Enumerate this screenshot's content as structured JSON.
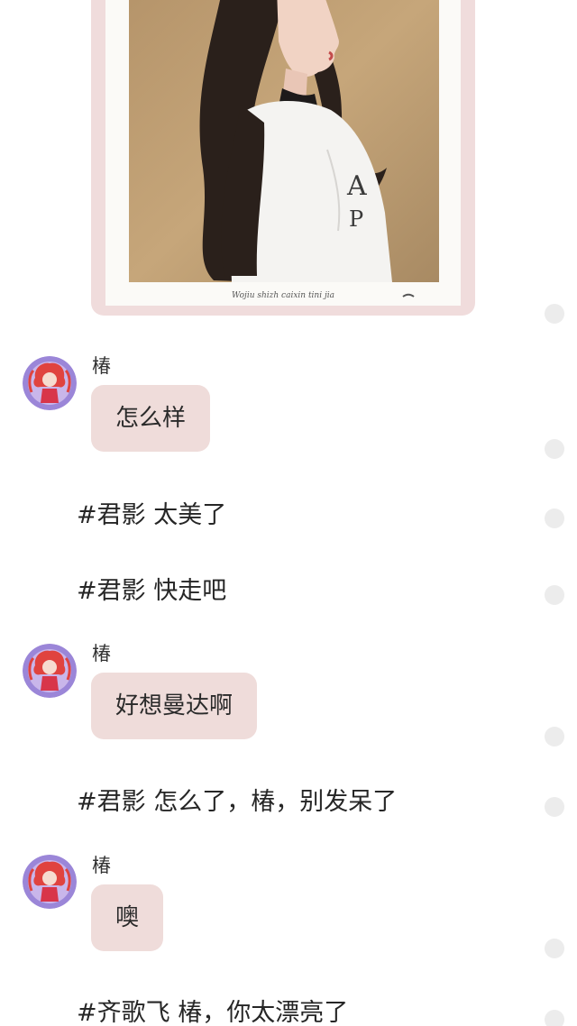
{
  "photo": {
    "caption": "Wojiu shizh caixin tini jia"
  },
  "messages": [
    {
      "type": "chat",
      "sender": "椿",
      "text": "怎么样"
    },
    {
      "type": "narration",
      "text": "#君影 太美了"
    },
    {
      "type": "narration",
      "text": "#君影 快走吧"
    },
    {
      "type": "chat",
      "sender": "椿",
      "text": "好想曼达啊"
    },
    {
      "type": "narration",
      "text": "#君影 怎么了，椿，别发呆了"
    },
    {
      "type": "chat",
      "sender": "椿",
      "text": "噢"
    },
    {
      "type": "narration",
      "text": "#齐歌飞 椿，你太漂亮了"
    }
  ],
  "colors": {
    "bubble": "#efdcda",
    "photo_frame": "#f0dcdc",
    "dot": "#ececec",
    "avatar_bg": "#9b86d8"
  }
}
